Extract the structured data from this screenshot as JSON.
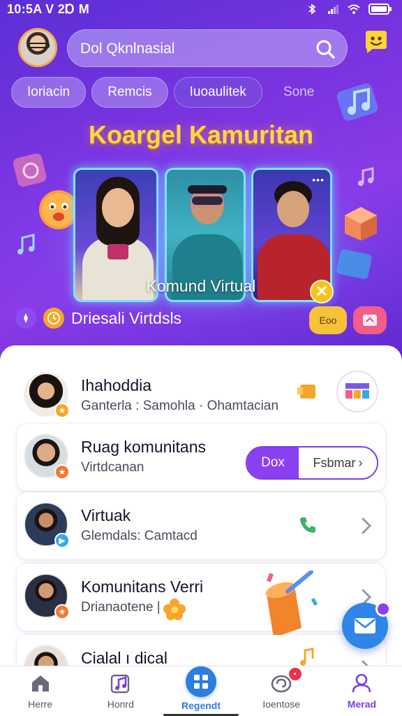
{
  "status_bar": {
    "time": "10:5A V 2Ɒ M"
  },
  "header": {
    "search_text": "Dol Qknlnasial",
    "chips": [
      "Ioriacin",
      "Remcis",
      "Iuoaulitek",
      "Sone"
    ]
  },
  "hero": {
    "title": "Koargel Kamuritan",
    "caption": "Komund Virtual",
    "subtitle": "Driesali Virtdsls",
    "pill_label": "Eoo"
  },
  "list": [
    {
      "title": "Ihahoddia",
      "subtitle": "Ganterla : Samohla · Ohamtacian"
    },
    {
      "title": "Ruag komunitans",
      "subtitle": "Virtdcanan",
      "segment": [
        "Dox",
        "Fsbmar"
      ]
    },
    {
      "title": "Virtuak",
      "subtitle": "Glemdals: Camtacd"
    },
    {
      "title": "Komunitans Verri",
      "subtitle": "Drianaotene |"
    },
    {
      "title": "Cialal ı dical",
      "subtitle": ""
    }
  ],
  "bottom_nav": [
    {
      "label": "Herre",
      "icon": "home-icon"
    },
    {
      "label": "Honrd",
      "icon": "music-icon"
    },
    {
      "label": "Regendt",
      "icon": "grid-icon"
    },
    {
      "label": "Ioentose",
      "icon": "spiral-icon"
    },
    {
      "label": "Merad",
      "icon": "profile-icon"
    }
  ],
  "colors": {
    "hero_purple": "#7b34e0",
    "title_yellow": "#ffd54a",
    "accent_purple": "#8a3ff0",
    "accent_blue": "#2c7de0"
  }
}
